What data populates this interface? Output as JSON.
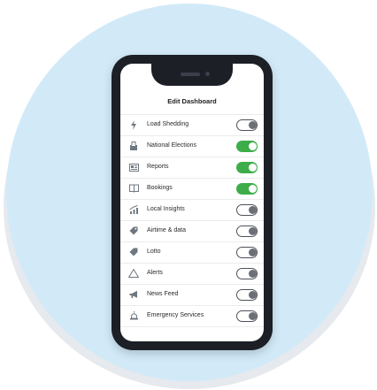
{
  "title": "Edit Dashboard",
  "accent_color": "#3dad4a",
  "items": [
    {
      "label": "Load Shedding",
      "icon": "lightning-icon",
      "enabled": false
    },
    {
      "label": "National Elections",
      "icon": "ballot-box-icon",
      "enabled": true
    },
    {
      "label": "Reports",
      "icon": "newspaper-icon",
      "enabled": true
    },
    {
      "label": "Bookings",
      "icon": "book-icon",
      "enabled": true
    },
    {
      "label": "Local Insights",
      "icon": "chart-icon",
      "enabled": false
    },
    {
      "label": "Airtime & data",
      "icon": "tag-icon",
      "enabled": false
    },
    {
      "label": "Lotto",
      "icon": "ticket-icon",
      "enabled": false
    },
    {
      "label": "Alerts",
      "icon": "warning-icon",
      "enabled": false
    },
    {
      "label": "News Feed",
      "icon": "megaphone-icon",
      "enabled": false
    },
    {
      "label": "Emergency Services",
      "icon": "siren-icon",
      "enabled": false
    }
  ]
}
